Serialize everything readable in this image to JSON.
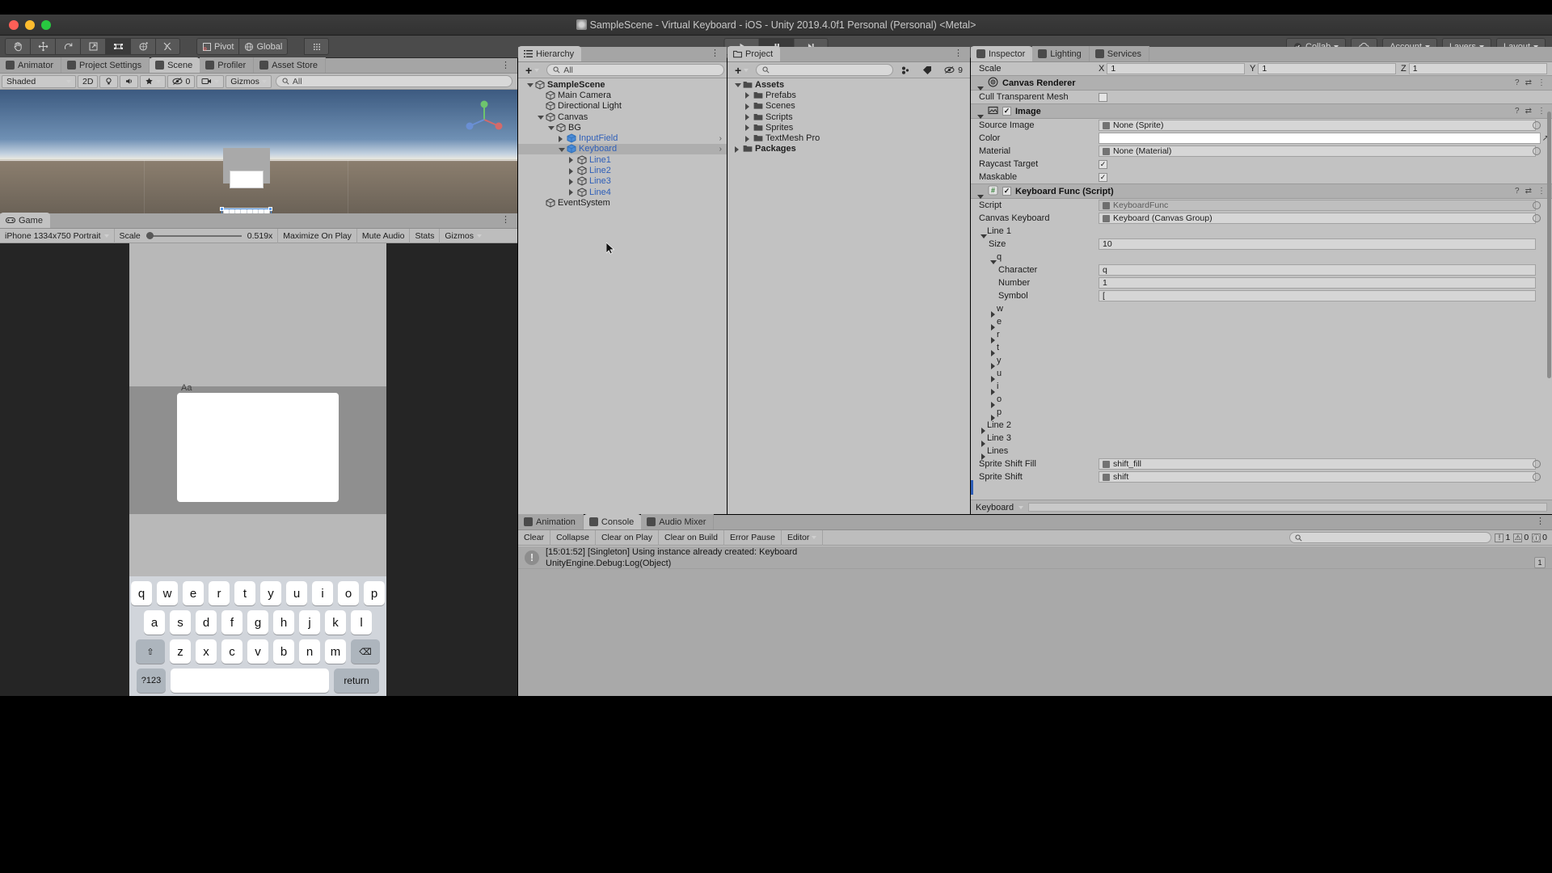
{
  "window": {
    "title": "SampleScene - Virtual Keyboard - iOS - Unity 2019.4.0f1 Personal (Personal) <Metal>",
    "app_icon": "unity-icon"
  },
  "toolbar": {
    "tools": [
      "hand-tool",
      "move-tool",
      "rotate-tool",
      "scale-tool",
      "rect-tool",
      "transform-tool",
      "custom-tool"
    ],
    "pivot_label": "Pivot",
    "global_label": "Global",
    "grid_label": "grid-snap-icon",
    "play_label": "▶",
    "pause_label": "❙❙",
    "step_label": "▶❙",
    "collab_label": "Collab",
    "cloud_label": "cloud-icon",
    "account_label": "Account",
    "layers_label": "Layers",
    "layout_label": "Layout"
  },
  "scene": {
    "tabs": [
      {
        "label": "Animator",
        "icon": "animator-icon",
        "selected": false
      },
      {
        "label": "Project Settings",
        "icon": "gear-icon",
        "selected": false
      },
      {
        "label": "Scene",
        "icon": "scene-icon",
        "selected": true
      },
      {
        "label": "Profiler",
        "icon": "profiler-icon",
        "selected": false
      },
      {
        "label": "Asset Store",
        "icon": "store-icon",
        "selected": false
      }
    ],
    "shading_mode": "Shaded",
    "mode_2d": "2D",
    "light_icon": "lighting-icon",
    "audio_icon": "audio-icon",
    "fx_icon": "fx-icon",
    "visibility_count": "0",
    "gizmos_label": "Gizmos",
    "search_placeholder": "All"
  },
  "game": {
    "tab_label": "Game",
    "resolution": "iPhone 1334x750 Portrait",
    "scale_label": "Scale",
    "scale_value": "0.519x",
    "maximize_label": "Maximize On Play",
    "mute_label": "Mute Audio",
    "stats_label": "Stats",
    "gizmos_label": "Gizmos",
    "input_placeholder": "Aa",
    "keyboard": {
      "row1": [
        "q",
        "w",
        "e",
        "r",
        "t",
        "y",
        "u",
        "i",
        "o",
        "p"
      ],
      "row2": [
        "a",
        "s",
        "d",
        "f",
        "g",
        "h",
        "j",
        "k",
        "l"
      ],
      "row3_shift": "⇧",
      "row3": [
        "z",
        "x",
        "c",
        "v",
        "b",
        "n",
        "m"
      ],
      "row3_backspace": "⌫",
      "numeric_label": "?123",
      "space_label": "",
      "return_label": "return"
    }
  },
  "hierarchy": {
    "tab_label": "Hierarchy",
    "add_label": "+",
    "search_placeholder": "All",
    "items": [
      {
        "label": "SampleScene",
        "depth": 0,
        "icon": "scene-icon",
        "arrow": "open",
        "bold": true,
        "blue": false,
        "selected": false,
        "chevron": false
      },
      {
        "label": "Main Camera",
        "depth": 1,
        "icon": "gameobject-icon",
        "arrow": "none",
        "bold": false,
        "blue": false,
        "selected": false,
        "chevron": false
      },
      {
        "label": "Directional Light",
        "depth": 1,
        "icon": "gameobject-icon",
        "arrow": "none",
        "bold": false,
        "blue": false,
        "selected": false,
        "chevron": false
      },
      {
        "label": "Canvas",
        "depth": 1,
        "icon": "gameobject-icon",
        "arrow": "open",
        "bold": false,
        "blue": false,
        "selected": false,
        "chevron": false
      },
      {
        "label": "BG",
        "depth": 2,
        "icon": "gameobject-icon",
        "arrow": "open",
        "bold": false,
        "blue": false,
        "selected": false,
        "chevron": false
      },
      {
        "label": "InputField",
        "depth": 3,
        "icon": "prefab-icon",
        "arrow": "closed",
        "bold": false,
        "blue": true,
        "selected": false,
        "chevron": true
      },
      {
        "label": "Keyboard",
        "depth": 3,
        "icon": "prefab-icon",
        "arrow": "open",
        "bold": false,
        "blue": true,
        "selected": true,
        "chevron": true
      },
      {
        "label": "Line1",
        "depth": 4,
        "icon": "gameobject-icon",
        "arrow": "closed",
        "bold": false,
        "blue": true,
        "selected": false,
        "chevron": false
      },
      {
        "label": "Line2",
        "depth": 4,
        "icon": "gameobject-icon",
        "arrow": "closed",
        "bold": false,
        "blue": true,
        "selected": false,
        "chevron": false
      },
      {
        "label": "Line3",
        "depth": 4,
        "icon": "gameobject-icon",
        "arrow": "closed",
        "bold": false,
        "blue": true,
        "selected": false,
        "chevron": false
      },
      {
        "label": "Line4",
        "depth": 4,
        "icon": "gameobject-icon",
        "arrow": "closed",
        "bold": false,
        "blue": true,
        "selected": false,
        "chevron": false
      },
      {
        "label": "EventSystem",
        "depth": 1,
        "icon": "gameobject-icon",
        "arrow": "none",
        "bold": false,
        "blue": false,
        "selected": false,
        "chevron": false
      }
    ]
  },
  "project": {
    "tab_label": "Project",
    "add_label": "+",
    "search_placeholder": "",
    "visibility_count": "9",
    "items": [
      {
        "label": "Assets",
        "depth": 0,
        "arrow": "open",
        "bold": true
      },
      {
        "label": "Prefabs",
        "depth": 1,
        "arrow": "closed",
        "bold": false
      },
      {
        "label": "Scenes",
        "depth": 1,
        "arrow": "closed",
        "bold": false
      },
      {
        "label": "Scripts",
        "depth": 1,
        "arrow": "closed",
        "bold": false
      },
      {
        "label": "Sprites",
        "depth": 1,
        "arrow": "closed",
        "bold": false
      },
      {
        "label": "TextMesh Pro",
        "depth": 1,
        "arrow": "closed",
        "bold": false
      },
      {
        "label": "Packages",
        "depth": 0,
        "arrow": "closed",
        "bold": true
      }
    ]
  },
  "inspector": {
    "tabs": [
      {
        "label": "Inspector",
        "icon": "inspector-icon",
        "selected": true
      },
      {
        "label": "Lighting",
        "icon": "lighting-icon",
        "selected": false
      },
      {
        "label": "Services",
        "icon": "services-icon",
        "selected": false
      }
    ],
    "scale_row": {
      "label": "Scale",
      "axes": [
        {
          "axis": "X",
          "value": "1"
        },
        {
          "axis": "Y",
          "value": "1"
        },
        {
          "axis": "Z",
          "value": "1"
        }
      ]
    },
    "components": [
      {
        "name": "Canvas Renderer",
        "icon": "canvas-renderer-icon",
        "has_checkbox": false,
        "rows": [
          {
            "label": "Cull Transparent Mesh",
            "type": "checkbox",
            "value": false
          }
        ]
      },
      {
        "name": "Image",
        "icon": "image-icon",
        "has_checkbox": true,
        "checked": true,
        "rows": [
          {
            "label": "Source Image",
            "type": "object",
            "value": "None (Sprite)"
          },
          {
            "label": "Color",
            "type": "color",
            "value": "#FFFFFF"
          },
          {
            "label": "Material",
            "type": "object",
            "value": "None (Material)"
          },
          {
            "label": "Raycast Target",
            "type": "checkbox",
            "value": true
          },
          {
            "label": "Maskable",
            "type": "checkbox",
            "value": true
          }
        ]
      },
      {
        "name": "Keyboard Func (Script)",
        "icon": "script-icon",
        "has_checkbox": true,
        "checked": true,
        "rows": [
          {
            "label": "Script",
            "type": "object-gray",
            "value": "KeyboardFunc"
          },
          {
            "label": "Canvas Keyboard",
            "type": "object",
            "value": "Keyboard (Canvas Group)"
          },
          {
            "label": "Line 1",
            "type": "foldout-open",
            "value": ""
          },
          {
            "label": "Size",
            "type": "text",
            "value": "10",
            "indent": 1
          },
          {
            "label": "q",
            "type": "foldout-open",
            "value": "",
            "indent": 1
          },
          {
            "label": "Character",
            "type": "text",
            "value": "q",
            "indent": 2
          },
          {
            "label": "Number",
            "type": "text",
            "value": "1",
            "indent": 2
          },
          {
            "label": "Symbol",
            "type": "text",
            "value": "[",
            "indent": 2
          },
          {
            "label": "w",
            "type": "foldout-closed",
            "value": "",
            "indent": 1
          },
          {
            "label": "e",
            "type": "foldout-closed",
            "value": "",
            "indent": 1
          },
          {
            "label": "r",
            "type": "foldout-closed",
            "value": "",
            "indent": 1
          },
          {
            "label": "t",
            "type": "foldout-closed",
            "value": "",
            "indent": 1
          },
          {
            "label": "y",
            "type": "foldout-closed",
            "value": "",
            "indent": 1
          },
          {
            "label": "u",
            "type": "foldout-closed",
            "value": "",
            "indent": 1
          },
          {
            "label": "i",
            "type": "foldout-closed",
            "value": "",
            "indent": 1
          },
          {
            "label": "o",
            "type": "foldout-closed",
            "value": "",
            "indent": 1
          },
          {
            "label": "p",
            "type": "foldout-closed",
            "value": "",
            "indent": 1
          },
          {
            "label": "Line 2",
            "type": "foldout-closed",
            "value": ""
          },
          {
            "label": "Line 3",
            "type": "foldout-closed",
            "value": ""
          },
          {
            "label": "Lines",
            "type": "foldout-closed",
            "value": ""
          },
          {
            "label": "Sprite Shift Fill",
            "type": "object",
            "value": "shift_fill"
          },
          {
            "label": "Sprite Shift",
            "type": "object",
            "value": "shift"
          }
        ]
      }
    ],
    "footer_label": "Keyboard"
  },
  "console": {
    "tabs": [
      {
        "label": "Animation",
        "icon": "animation-icon",
        "selected": false
      },
      {
        "label": "Console",
        "icon": "console-icon",
        "selected": true
      },
      {
        "label": "Audio Mixer",
        "icon": "audio-mixer-icon",
        "selected": false
      }
    ],
    "buttons": [
      "Clear",
      "Collapse",
      "Clear on Play",
      "Clear on Build",
      "Error Pause"
    ],
    "editor_label": "Editor",
    "search_placeholder": "",
    "counts": {
      "error": "1",
      "warning": "0",
      "info": "0"
    },
    "entries": [
      {
        "icon": "info-icon",
        "line1": "[15:01:52] [Singleton] Using instance already created: Keyboard",
        "line2": "UnityEngine.Debug:Log(Object)"
      }
    ],
    "entry_badge": "1"
  },
  "colors": {
    "panel_bg": "#c2c2c2",
    "toolbar_bg": "#4b4b4b",
    "accent_blue": "#2f5fb8",
    "selection": "#aeaeae"
  }
}
